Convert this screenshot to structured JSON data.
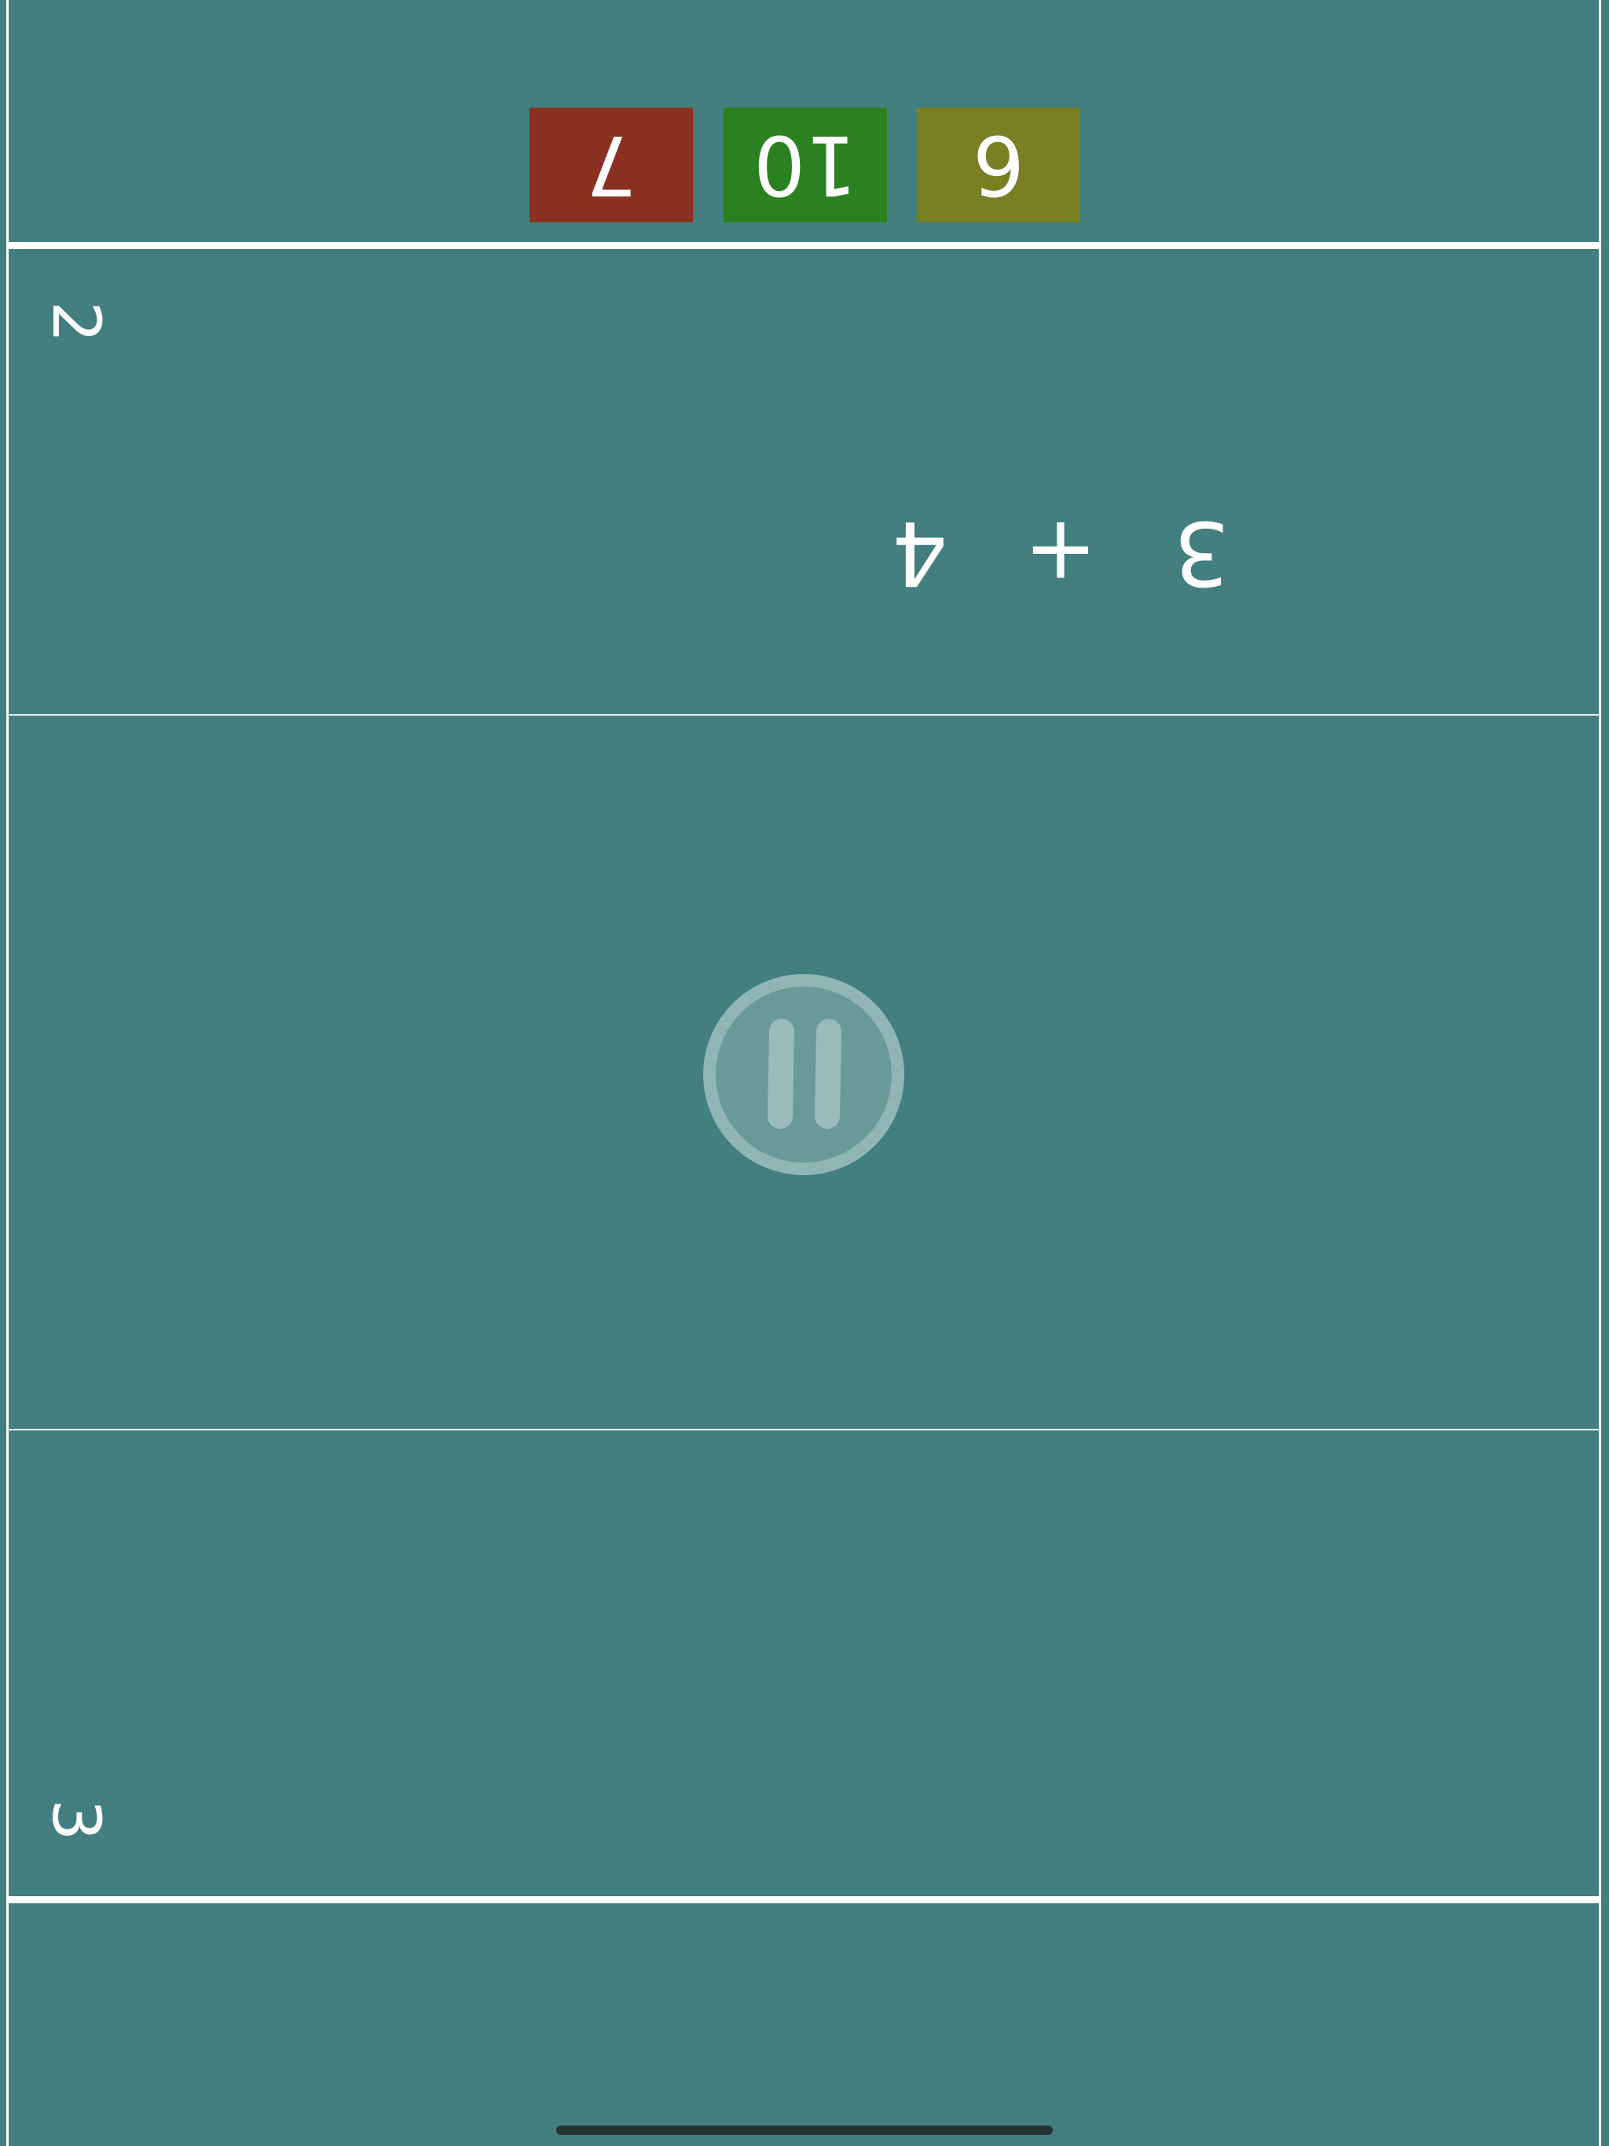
{
  "top_player": {
    "score": "2",
    "equation": {
      "left": "3",
      "operator": "+",
      "right": "4"
    },
    "answers": [
      {
        "value": "7",
        "color": "#8a3122"
      },
      {
        "value": "10",
        "color": "#2b8020"
      },
      {
        "value": "6",
        "color": "#7a7f24"
      }
    ]
  },
  "bottom_player": {
    "score": "3"
  },
  "pause": {
    "icon": "pause-icon"
  },
  "colors": {
    "background": "#427f7e",
    "lines": "#ffffff"
  }
}
